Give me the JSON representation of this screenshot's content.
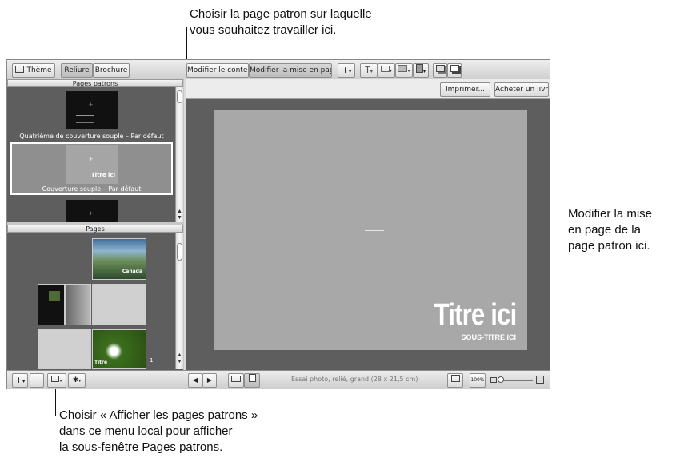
{
  "callouts": {
    "top": [
      "Choisir la page patron sur laquelle",
      "vous souhaitez travailler ici."
    ],
    "right": [
      "Modifier la mise",
      "en page de la",
      "page patron ici."
    ],
    "bottom": [
      "Choisir « Afficher les pages patrons »",
      "dans ce menu local pour afficher",
      "la sous-fenêtre Pages patrons."
    ]
  },
  "toolbar": {
    "theme_label": "Thème",
    "binding_tabs": [
      "Reliure",
      "Brochure"
    ],
    "edit_tabs": [
      "Modifier le contenu",
      "Modifier la mise en page"
    ],
    "add_symbol": "+",
    "text_symbol": "T",
    "print_label": "Imprimer...",
    "buy_label": "Acheter un livre..."
  },
  "master_panel": {
    "header": "Pages patrons",
    "items": [
      {
        "label": "Quatrième de couverture souple – Par défaut",
        "selected": false
      },
      {
        "label": "Couverture souple – Par défaut",
        "selected": true,
        "thumb_title": "Titre ici"
      }
    ]
  },
  "pages_panel": {
    "header": "Pages",
    "thumbs": [
      {
        "caption": "Canada"
      },
      {
        "caption": ""
      },
      {
        "caption": ""
      },
      {
        "caption": ""
      },
      {
        "caption": "Titre"
      }
    ],
    "page_number": "1"
  },
  "canvas": {
    "title": "Titre ici",
    "subtitle": "SOUS-TITRE ICI"
  },
  "statusbar": {
    "product": "Essai photo, relié, grand (28 x 21,5 cm)",
    "zoom_label": "100%",
    "zoom_value": 0.1
  },
  "bottom_left": {
    "add_symbol": "+",
    "remove_symbol": "−"
  },
  "colors": {
    "canvas": "#a8a8a8",
    "panel": "#5e5e5e",
    "selection": "#ffffff"
  }
}
